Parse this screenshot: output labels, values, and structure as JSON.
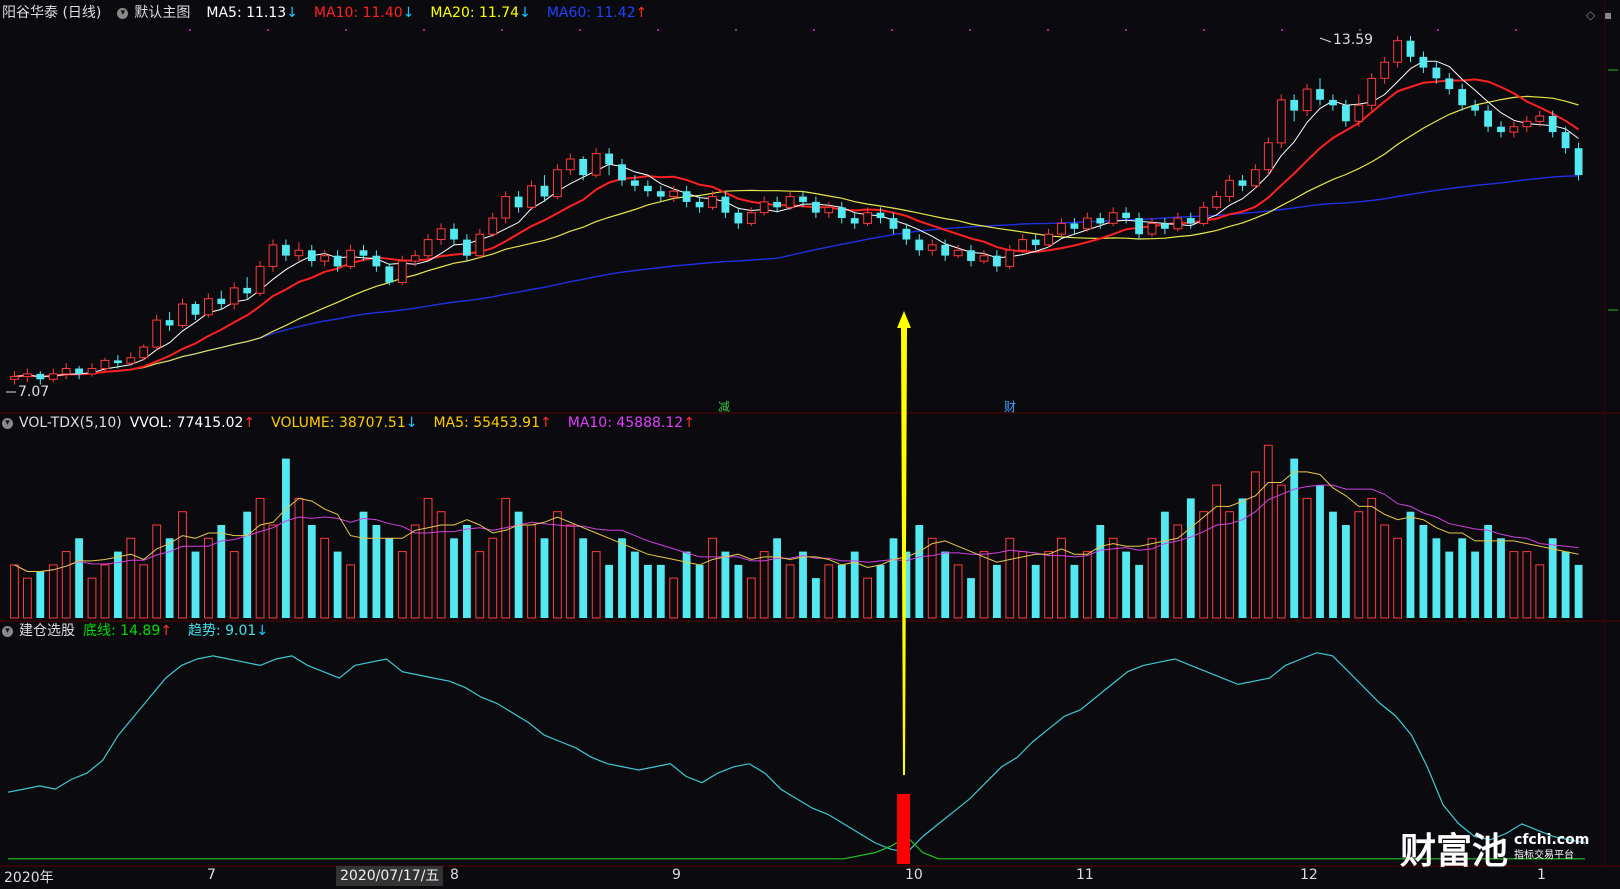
{
  "main_panel": {
    "stock_name": "阳谷华泰 (日线)",
    "chart_type": "默认主图",
    "ma5": {
      "label": "MA5: 11.13",
      "arrow": "↓",
      "color": "#ffffff"
    },
    "ma10": {
      "label": "MA10: 11.40",
      "arrow": "↓",
      "color": "#ff2020"
    },
    "ma20": {
      "label": "MA20: 11.74",
      "arrow": "↓",
      "color": "#ffff00"
    },
    "ma60": {
      "label": "MA60: 11.42",
      "arrow": "↑",
      "color": "#2020ff"
    },
    "high_marker": "13.59",
    "low_marker": "7.07",
    "event_marker_1": "减",
    "event_marker_2": "财"
  },
  "volume_panel": {
    "indicator": "VOL-TDX(5,10)",
    "vvol": {
      "label": "VVOL: 77415.02",
      "arrow": "↑",
      "color": "#ffffff"
    },
    "volume": {
      "label": "VOLUME: 38707.51",
      "arrow": "↓",
      "color": "#ffcc00"
    },
    "ma5": {
      "label": "MA5: 55453.91",
      "arrow": "↑",
      "color": "#ffcc00"
    },
    "ma10": {
      "label": "MA10: 45888.12",
      "arrow": "↑",
      "color": "#e040fb"
    }
  },
  "indicator_panel": {
    "name": "建仓选股",
    "bottom_line": {
      "label": "底线: 14.89",
      "arrow": "↑",
      "color": "#00dd00"
    },
    "trend": {
      "label": "趋势: 9.01",
      "arrow": "↓",
      "color": "#40e0e8"
    }
  },
  "x_axis": {
    "year_label": "2020年",
    "month_labels": [
      "7",
      "8",
      "9",
      "10",
      "11",
      "12",
      "1"
    ],
    "selected_date": "2020/07/17/五"
  },
  "watermark": {
    "brand": "财富池",
    "url": "cfchi.com",
    "subtitle": "指标交易平台"
  },
  "colors": {
    "up": "#ff3a3a",
    "down": "#54e8f0",
    "ma5": "#ffffff",
    "ma10": "#ff2020",
    "ma20": "#e6e64a",
    "ma60": "#2030e0",
    "vol_ma5": "#e6c84a",
    "vol_ma10": "#d040e0",
    "trend": "#40c8d0",
    "bottom": "#20c820",
    "arrow": "#ffff00",
    "signal": "#ff0000"
  },
  "chart_data": {
    "type": "candlestick",
    "price_range": [
      7.07,
      13.59
    ],
    "candles": [
      [
        7.2,
        7.25,
        7.1,
        7.35
      ],
      [
        7.25,
        7.3,
        7.15,
        7.4
      ],
      [
        7.3,
        7.2,
        7.1,
        7.35
      ],
      [
        7.2,
        7.3,
        7.15,
        7.4
      ],
      [
        7.3,
        7.4,
        7.2,
        7.5
      ],
      [
        7.4,
        7.3,
        7.2,
        7.45
      ],
      [
        7.3,
        7.4,
        7.25,
        7.5
      ],
      [
        7.4,
        7.55,
        7.35,
        7.6
      ],
      [
        7.55,
        7.5,
        7.4,
        7.65
      ],
      [
        7.5,
        7.6,
        7.45,
        7.7
      ],
      [
        7.6,
        7.8,
        7.55,
        7.85
      ],
      [
        7.8,
        8.3,
        7.75,
        8.4
      ],
      [
        8.3,
        8.2,
        8.1,
        8.45
      ],
      [
        8.2,
        8.6,
        8.15,
        8.7
      ],
      [
        8.6,
        8.4,
        8.3,
        8.65
      ],
      [
        8.4,
        8.7,
        8.35,
        8.8
      ],
      [
        8.7,
        8.6,
        8.5,
        8.85
      ],
      [
        8.6,
        8.9,
        8.5,
        9.0
      ],
      [
        8.9,
        8.8,
        8.7,
        9.1
      ],
      [
        8.8,
        9.3,
        8.75,
        9.4
      ],
      [
        9.3,
        9.7,
        9.2,
        9.8
      ],
      [
        9.7,
        9.5,
        9.4,
        9.8
      ],
      [
        9.5,
        9.6,
        9.4,
        9.75
      ],
      [
        9.6,
        9.4,
        9.3,
        9.7
      ],
      [
        9.4,
        9.5,
        9.3,
        9.6
      ],
      [
        9.5,
        9.3,
        9.2,
        9.6
      ],
      [
        9.3,
        9.6,
        9.25,
        9.7
      ],
      [
        9.6,
        9.5,
        9.4,
        9.7
      ],
      [
        9.5,
        9.3,
        9.2,
        9.6
      ],
      [
        9.3,
        9.0,
        8.95,
        9.35
      ],
      [
        9.0,
        9.4,
        8.95,
        9.5
      ],
      [
        9.4,
        9.5,
        9.3,
        9.6
      ],
      [
        9.5,
        9.8,
        9.45,
        9.9
      ],
      [
        9.8,
        10.0,
        9.7,
        10.1
      ],
      [
        10.0,
        9.8,
        9.7,
        10.1
      ],
      [
        9.8,
        9.5,
        9.4,
        9.9
      ],
      [
        9.5,
        9.9,
        9.45,
        10.0
      ],
      [
        9.9,
        10.2,
        9.85,
        10.3
      ],
      [
        10.2,
        10.6,
        10.1,
        10.7
      ],
      [
        10.6,
        10.4,
        10.3,
        10.7
      ],
      [
        10.4,
        10.8,
        10.35,
        10.9
      ],
      [
        10.8,
        10.6,
        10.5,
        11.0
      ],
      [
        10.6,
        11.1,
        10.55,
        11.2
      ],
      [
        11.1,
        11.3,
        11.0,
        11.4
      ],
      [
        11.3,
        11.0,
        10.9,
        11.35
      ],
      [
        11.0,
        11.4,
        10.95,
        11.5
      ],
      [
        11.4,
        11.2,
        11.0,
        11.5
      ],
      [
        11.2,
        10.9,
        10.8,
        11.3
      ],
      [
        10.9,
        10.8,
        10.7,
        11.0
      ],
      [
        10.8,
        10.7,
        10.6,
        10.9
      ],
      [
        10.7,
        10.6,
        10.5,
        10.8
      ],
      [
        10.6,
        10.7,
        10.5,
        10.8
      ],
      [
        10.7,
        10.5,
        10.4,
        10.8
      ],
      [
        10.5,
        10.4,
        10.3,
        10.6
      ],
      [
        10.4,
        10.6,
        10.35,
        10.7
      ],
      [
        10.6,
        10.3,
        10.2,
        10.7
      ],
      [
        10.3,
        10.1,
        10.0,
        10.4
      ],
      [
        10.1,
        10.3,
        10.05,
        10.4
      ],
      [
        10.3,
        10.5,
        10.25,
        10.6
      ],
      [
        10.5,
        10.4,
        10.3,
        10.6
      ],
      [
        10.4,
        10.6,
        10.35,
        10.7
      ],
      [
        10.6,
        10.5,
        10.4,
        10.7
      ],
      [
        10.5,
        10.3,
        10.2,
        10.6
      ],
      [
        10.3,
        10.4,
        10.2,
        10.5
      ],
      [
        10.4,
        10.2,
        10.1,
        10.5
      ],
      [
        10.2,
        10.1,
        10.0,
        10.3
      ],
      [
        10.1,
        10.3,
        10.05,
        10.4
      ],
      [
        10.3,
        10.2,
        10.1,
        10.4
      ],
      [
        10.2,
        10.0,
        9.9,
        10.3
      ],
      [
        10.0,
        9.8,
        9.7,
        10.1
      ],
      [
        9.8,
        9.6,
        9.5,
        9.9
      ],
      [
        9.6,
        9.7,
        9.5,
        9.8
      ],
      [
        9.7,
        9.5,
        9.4,
        9.8
      ],
      [
        9.5,
        9.6,
        9.45,
        9.7
      ],
      [
        9.6,
        9.4,
        9.3,
        9.7
      ],
      [
        9.4,
        9.5,
        9.35,
        9.6
      ],
      [
        9.5,
        9.3,
        9.2,
        9.6
      ],
      [
        9.3,
        9.6,
        9.25,
        9.7
      ],
      [
        9.6,
        9.8,
        9.55,
        9.9
      ],
      [
        9.8,
        9.7,
        9.6,
        9.9
      ],
      [
        9.7,
        9.9,
        9.65,
        10.0
      ],
      [
        9.9,
        10.1,
        9.85,
        10.2
      ],
      [
        10.1,
        10.0,
        9.9,
        10.2
      ],
      [
        10.0,
        10.2,
        9.95,
        10.3
      ],
      [
        10.2,
        10.1,
        10.0,
        10.3
      ],
      [
        10.1,
        10.3,
        10.05,
        10.4
      ],
      [
        10.3,
        10.2,
        10.1,
        10.4
      ],
      [
        10.2,
        9.9,
        9.8,
        10.3
      ],
      [
        9.9,
        10.1,
        9.85,
        10.2
      ],
      [
        10.1,
        10.0,
        9.9,
        10.2
      ],
      [
        10.0,
        10.2,
        9.95,
        10.3
      ],
      [
        10.2,
        10.1,
        10.0,
        10.3
      ],
      [
        10.1,
        10.4,
        10.05,
        10.5
      ],
      [
        10.4,
        10.6,
        10.35,
        10.7
      ],
      [
        10.6,
        10.9,
        10.5,
        11.0
      ],
      [
        10.9,
        10.8,
        10.7,
        11.0
      ],
      [
        10.8,
        11.1,
        10.75,
        11.2
      ],
      [
        11.1,
        11.6,
        11.0,
        11.7
      ],
      [
        11.6,
        12.4,
        11.5,
        12.5
      ],
      [
        12.4,
        12.2,
        12.0,
        12.5
      ],
      [
        12.2,
        12.6,
        12.1,
        12.7
      ],
      [
        12.6,
        12.4,
        12.3,
        12.8
      ],
      [
        12.4,
        12.3,
        12.2,
        12.5
      ],
      [
        12.3,
        12.0,
        11.9,
        12.4
      ],
      [
        12.0,
        12.3,
        11.9,
        12.5
      ],
      [
        12.3,
        12.8,
        12.2,
        12.9
      ],
      [
        12.8,
        13.1,
        12.7,
        13.2
      ],
      [
        13.1,
        13.5,
        13.0,
        13.59
      ],
      [
        13.5,
        13.2,
        13.1,
        13.59
      ],
      [
        13.2,
        13.0,
        12.9,
        13.3
      ],
      [
        13.0,
        12.8,
        12.7,
        13.1
      ],
      [
        12.8,
        12.6,
        12.5,
        12.9
      ],
      [
        12.6,
        12.3,
        12.2,
        12.7
      ],
      [
        12.3,
        12.2,
        12.1,
        12.4
      ],
      [
        12.2,
        11.9,
        11.8,
        12.3
      ],
      [
        11.9,
        11.8,
        11.7,
        12.0
      ],
      [
        11.8,
        11.9,
        11.7,
        12.0
      ],
      [
        11.9,
        12.0,
        11.8,
        12.1
      ],
      [
        12.0,
        12.1,
        11.9,
        12.2
      ],
      [
        12.1,
        11.8,
        11.7,
        12.2
      ],
      [
        11.8,
        11.5,
        11.4,
        11.9
      ],
      [
        11.5,
        11.0,
        10.9,
        11.6
      ]
    ],
    "volume": [
      4,
      3,
      3.5,
      4,
      5,
      6,
      3,
      4,
      5,
      6,
      4,
      7,
      6,
      8,
      5,
      6,
      7,
      5,
      8,
      9,
      7,
      12,
      9,
      7,
      6,
      5,
      4,
      8,
      7,
      6,
      5,
      7,
      9,
      8,
      6,
      7,
      5,
      6,
      9,
      8,
      7,
      6,
      8,
      7,
      6,
      5,
      4,
      6,
      5,
      4,
      4,
      3,
      5,
      4,
      6,
      5,
      4,
      3,
      5,
      6,
      4,
      5,
      3,
      4,
      4,
      5,
      3,
      4,
      6,
      5,
      7,
      6,
      5,
      4,
      3,
      5,
      4,
      6,
      5,
      4,
      5,
      6,
      4,
      5,
      7,
      6,
      5,
      4,
      6,
      8,
      7,
      9,
      8,
      10,
      8,
      9,
      11,
      13,
      10,
      12,
      9,
      10,
      8,
      7,
      8,
      9,
      7,
      6,
      8,
      7,
      6,
      5,
      6,
      5,
      7,
      6,
      5,
      5,
      4,
      6,
      5,
      4,
      6,
      7,
      6,
      5
    ],
    "trend_line": [
      22,
      23,
      24,
      23,
      26,
      28,
      32,
      40,
      46,
      52,
      58,
      62,
      64,
      65,
      64,
      63,
      62,
      64,
      65,
      62,
      60,
      58,
      62,
      63,
      64,
      60,
      59,
      58,
      57,
      55,
      52,
      50,
      47,
      44,
      40,
      38,
      36,
      33,
      31,
      30,
      29,
      30,
      31,
      27,
      25,
      28,
      30,
      31,
      28,
      23,
      20,
      17,
      15,
      12,
      9,
      6,
      4,
      3,
      8,
      12,
      16,
      20,
      25,
      30,
      33,
      38,
      42,
      46,
      48,
      52,
      56,
      60,
      62,
      63,
      64,
      62,
      60,
      58,
      56,
      57,
      58,
      62,
      64,
      66,
      65,
      60,
      55,
      50,
      46,
      40,
      30,
      18,
      12,
      8,
      7,
      9,
      12,
      10,
      8,
      7,
      6
    ],
    "bottom_line": [
      1,
      1,
      1,
      1,
      1,
      1,
      1,
      1,
      1,
      1,
      1,
      1,
      1,
      1,
      1,
      1,
      1,
      1,
      1,
      1,
      1,
      1,
      1,
      1,
      1,
      1,
      1,
      1,
      1,
      1,
      1,
      1,
      1,
      1,
      1,
      1,
      1,
      1,
      1,
      1,
      1,
      1,
      1,
      1,
      1,
      1,
      1,
      1,
      1,
      1,
      1,
      1,
      1,
      1,
      2,
      3,
      5,
      8,
      3,
      1,
      1,
      1,
      1,
      1,
      1,
      1,
      1,
      1,
      1,
      1,
      1,
      1,
      1,
      1,
      1,
      1,
      1,
      1,
      1,
      1,
      1,
      1,
      1,
      1,
      1,
      1,
      1,
      1,
      1,
      1,
      1,
      1,
      1,
      1,
      1,
      1,
      1,
      1,
      1,
      1,
      1
    ]
  }
}
